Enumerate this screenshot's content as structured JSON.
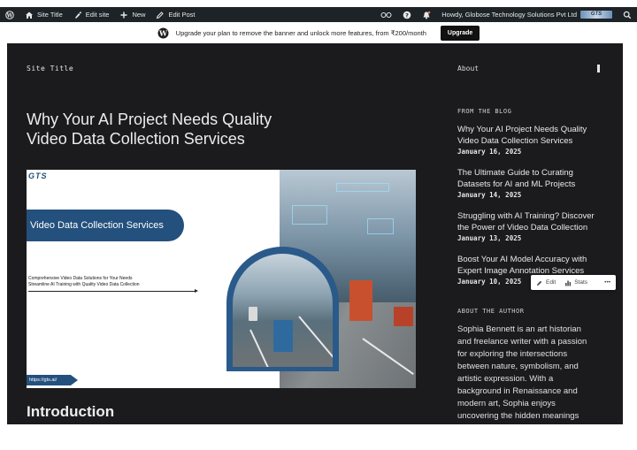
{
  "adminbar": {
    "site_title": "Site Title",
    "edit_site": "Edit site",
    "new": "New",
    "edit_post": "Edit Post",
    "howdy": "Howdy, Globose Technology Solutions Pvt Ltd",
    "avatar_text": "GTS"
  },
  "banner": {
    "text": "Upgrade your plan to remove the banner and unlock more features, from ₹200/month",
    "button": "Upgrade"
  },
  "header": {
    "site_title": "Site Title",
    "nav_about": "About"
  },
  "post": {
    "title": "Why Your AI Project Needs Quality Video Data Collection Services",
    "intro_heading": "Introduction"
  },
  "featured": {
    "logo": "GTS",
    "pill_text": "Video Data Collection Services",
    "desc_line1": "Comprehensive Video Data Solutions for Your Needs",
    "desc_line2": "Streamline AI Training with Quality Video Data Collection",
    "url": "https://gts.ai/"
  },
  "sidebar": {
    "from_blog": "FROM THE BLOG",
    "posts": [
      {
        "title": "Why Your AI Project Needs Quality Video Data Collection Services",
        "date": "January 16, 2025"
      },
      {
        "title": "The Ultimate Guide to Curating Datasets for AI and ML Projects",
        "date": "January 14, 2025"
      },
      {
        "title": "Struggling with AI Training? Discover the Power of Video Data Collection",
        "date": "January 13, 2025"
      },
      {
        "title": "Boost Your AI Model Accuracy with Expert Image Annotation Services",
        "date": "January 10, 2025"
      }
    ],
    "about_author": "ABOUT THE AUTHOR",
    "bio": "Sophia Bennett is an art historian and freelance writer with a passion for exploring the intersections between nature, symbolism, and artistic expression. With a background in Renaissance and modern art, Sophia enjoys uncovering the hidden meanings"
  },
  "popup": {
    "edit": "Edit",
    "stats": "Stats",
    "more": "•••"
  }
}
